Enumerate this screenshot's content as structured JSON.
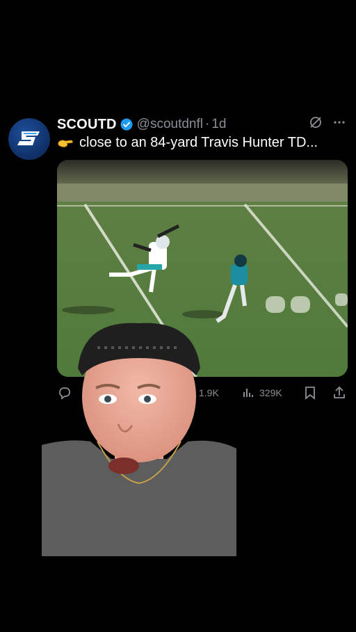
{
  "tweet": {
    "author_name": "SCOUTD",
    "handle": "@scoutdnfl",
    "separator": "·",
    "time": "1d",
    "text": "close to an 84-yard Travis Hunter TD...",
    "emoji": "pinching-hand-emoji"
  },
  "actions": {
    "likes": "1.9K",
    "views": "329K"
  },
  "colors": {
    "background": "#000000",
    "verified": "#1d9bf0",
    "muted": "#8b8f95",
    "avatar": "#1d4f9a"
  }
}
